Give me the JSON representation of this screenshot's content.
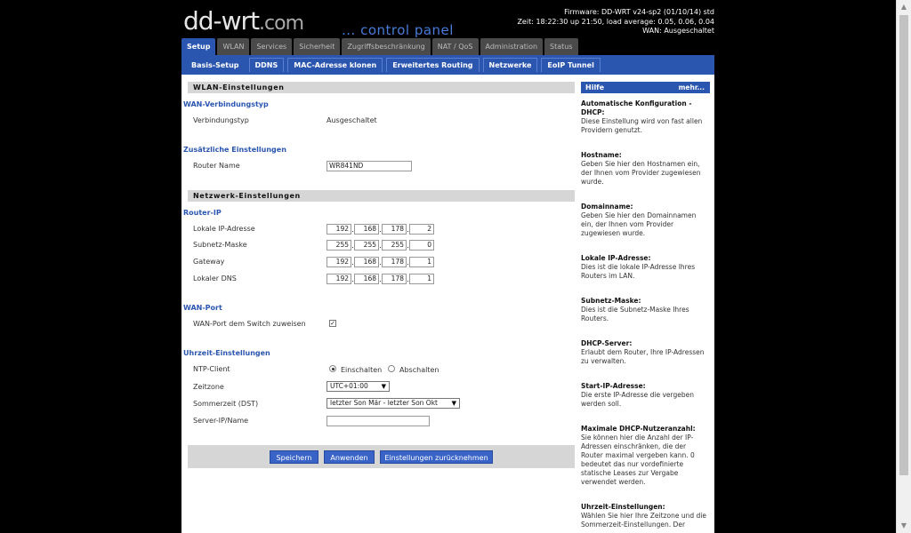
{
  "header": {
    "logo_main": "dd-wrt",
    "logo_com": ".com",
    "control_panel": "... control panel",
    "firmware": "Firmware: DD-WRT v24-sp2 (01/10/14) std",
    "time": "Zeit: 18:22:30 up 21:50, load average: 0.05, 0.06, 0.04",
    "wan": "WAN: Ausgeschaltet"
  },
  "tabs": [
    "Setup",
    "WLAN",
    "Services",
    "Sicherheit",
    "Zugriffsbeschränkung",
    "NAT / QoS",
    "Administration",
    "Status"
  ],
  "subtabs": [
    "Basis-Setup",
    "DDNS",
    "MAC-Adresse klonen",
    "Erweitertes Routing",
    "Netzwerke",
    "EoIP Tunnel"
  ],
  "wlan": {
    "section": "WLAN-Einstellungen",
    "type_head": "WAN-Verbindungstyp",
    "type_label": "Verbindungstyp",
    "type_value": "Ausgeschaltet",
    "extra_head": "Zusätzliche Einstellungen",
    "router_name_label": "Router Name",
    "router_name_value": "WR841ND"
  },
  "net": {
    "section": "Netzwerk-Einstellungen",
    "router_ip_head": "Router-IP",
    "local_ip_label": "Lokale IP-Adresse",
    "local_ip": [
      "192",
      "168",
      "178",
      "2"
    ],
    "subnet_label": "Subnetz-Maske",
    "subnet": [
      "255",
      "255",
      "255",
      "0"
    ],
    "gateway_label": "Gateway",
    "gateway": [
      "192",
      "168",
      "178",
      "1"
    ],
    "dns_label": "Lokaler DNS",
    "dns": [
      "192",
      "168",
      "178",
      "1"
    ],
    "wanport_head": "WAN-Port",
    "wanport_label": "WAN-Port dem Switch zuweisen",
    "time_head": "Uhrzeit-Einstellungen",
    "ntp_label": "NTP-Client",
    "ntp_on": "Einschalten",
    "ntp_off": "Abschalten",
    "tz_label": "Zeitzone",
    "tz_value": "UTC+01:00",
    "dst_label": "Sommerzeit (DST)",
    "dst_value": "letzter Son Mär - letzter Son Okt",
    "server_label": "Server-IP/Name",
    "server_value": ""
  },
  "buttons": {
    "save": "Speichern",
    "apply": "Anwenden",
    "reset": "Einstellungen zurücknehmen"
  },
  "help": {
    "head": "Hilfe",
    "more": "mehr...",
    "items": [
      {
        "title": "Automatische Konfiguration - DHCP:",
        "text": "Diese Einstellung wird von fast allen Providern genutzt."
      },
      {
        "title": "Hostname:",
        "text": "Geben Sie hier den Hostnamen ein, der Ihnen vom Provider zugewiesen wurde."
      },
      {
        "title": "Domainname:",
        "text": "Geben Sie hier den Domainnamen ein, der Ihnen vom Provider zugewiesen wurde."
      },
      {
        "title": "Lokale IP-Adresse:",
        "text": "Dies ist die lokale IP-Adresse Ihres Routers im LAN."
      },
      {
        "title": "Subnetz-Maske:",
        "text": "Dies ist die Subnetz-Maske Ihres Routers."
      },
      {
        "title": "DHCP-Server:",
        "text": "Erlaubt dem Router, Ihre IP-Adressen zu verwalten."
      },
      {
        "title": "Start-IP-Adresse:",
        "text": "Die erste IP-Adresse die vergeben werden soll."
      },
      {
        "title": "Maximale DHCP-Nutzeranzahl:",
        "text": "Sie können hier die Anzahl der IP-Adressen einschränken, die der Router maximal vergeben kann. 0 bedeutet das nur vordefinierte statische Leases zur Vergabe verwendet werden."
      },
      {
        "title": "Uhrzeit-Einstellungen:",
        "text": "Wählen Sie hier Ihre Zeitzone und die Sommerzeit-Einstellungen. Der"
      }
    ]
  }
}
